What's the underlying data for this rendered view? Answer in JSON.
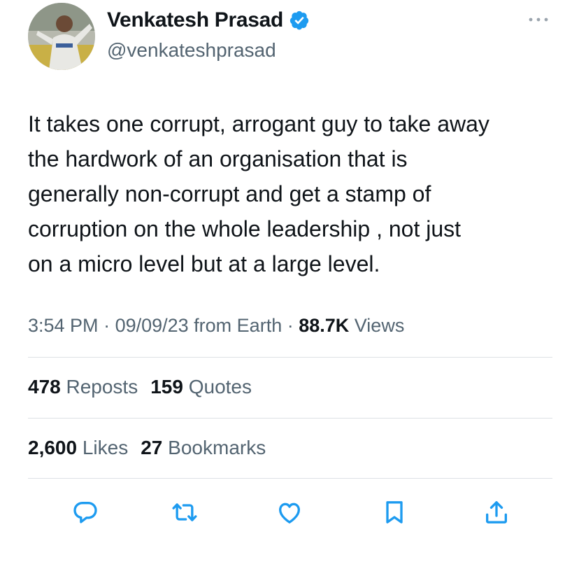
{
  "author": {
    "display_name": "Venkatesh Prasad",
    "handle": "@venkateshprasad",
    "verified_icon": "verified-badge-icon",
    "avatar_icon": "profile-photo"
  },
  "menu": {
    "more_icon": "more-horizontal-icon"
  },
  "tweet": {
    "text": "It takes one corrupt, arrogant guy to take away\nthe hardwork of an organisation that is\ngenerally non-corrupt and get a stamp of\ncorruption on the whole leadership , not just\non a micro level but at a large level."
  },
  "meta": {
    "time": "3:54 PM",
    "sep1": " · ",
    "date": "09/09/23",
    "source": " from Earth",
    "sep2": " · ",
    "views_count": "88.7K",
    "views_label": " Views"
  },
  "stats": {
    "reposts_count": "478",
    "reposts_label": " Reposts",
    "quotes_count": "159",
    "quotes_label": " Quotes",
    "likes_count": "2,600",
    "likes_label": " Likes",
    "bookmarks_count": "27",
    "bookmarks_label": " Bookmarks"
  },
  "actions": [
    {
      "icon": "reply-icon"
    },
    {
      "icon": "repost-icon"
    },
    {
      "icon": "like-icon"
    },
    {
      "icon": "bookmark-icon"
    },
    {
      "icon": "share-icon"
    }
  ],
  "colors": {
    "verified_blue": "#1d9bf0",
    "secondary_text": "#536471",
    "primary_text": "#0f1419",
    "divider": "#dde1e5"
  }
}
